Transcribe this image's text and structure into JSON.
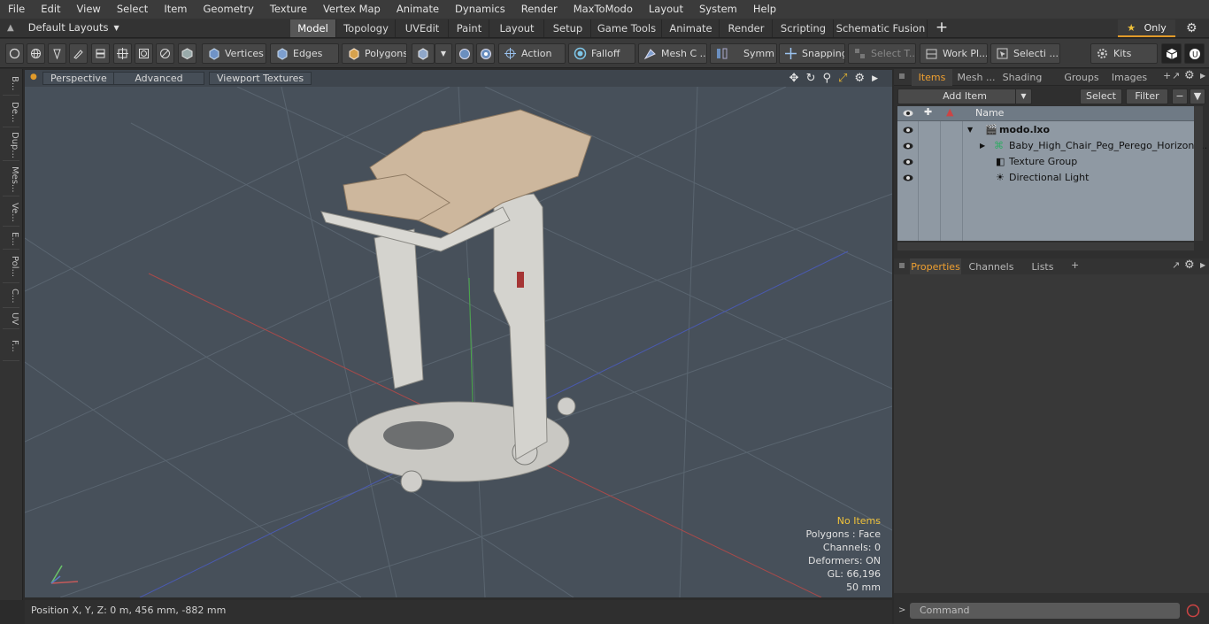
{
  "menubar": {
    "items": [
      "File",
      "Edit",
      "View",
      "Select",
      "Item",
      "Geometry",
      "Texture",
      "Vertex Map",
      "Animate",
      "Dynamics",
      "Render",
      "MaxToModo",
      "Layout",
      "System",
      "Help"
    ]
  },
  "layout_selector": "Default Layouts",
  "mode_tabs": [
    "Model",
    "Topology",
    "UVEdit",
    "Paint",
    "Layout",
    "Setup",
    "Game Tools",
    "Animate",
    "Render",
    "Scripting",
    "Schematic Fusion"
  ],
  "only_label": "Only",
  "toolbar": {
    "vertices": "Vertices",
    "edges": "Edges",
    "polygons": "Polygons",
    "action": "Action",
    "falloff": "Falloff",
    "mesh_c": "Mesh C ...",
    "symm": "Symm ...",
    "snapping": "Snapping",
    "select_t": "Select T...",
    "work_pl": "Work Pl...",
    "selecti": "Selecti ...",
    "kits": "Kits"
  },
  "left_tabs": [
    "B...",
    "De...",
    "Dup...",
    "Mes...",
    "Ve...",
    "E...",
    "Pol...",
    "C...",
    "UV",
    "F..."
  ],
  "viewport": {
    "perspective": "Perspective",
    "advanced": "Advanced",
    "viewport_textures": "Viewport Textures",
    "info": {
      "selection": "No Items",
      "polygons": "Polygons : Face",
      "channels": "Channels: 0",
      "deformers": "Deformers: ON",
      "gl": "GL: 66,196",
      "size": "50 mm"
    }
  },
  "status": "Position X, Y, Z:  0 m, 456 mm, -882 mm",
  "items_panel": {
    "tabs": [
      "Items",
      "Mesh ...",
      "Shading",
      "Groups",
      "Images"
    ],
    "add_item": "Add Item",
    "select": "Select",
    "filter": "Filter",
    "name_header": "Name",
    "rows": [
      {
        "label": "modo.lxo"
      },
      {
        "label": "Baby_High_Chair_Peg_Perego_Horizont..."
      },
      {
        "label": "Texture Group"
      },
      {
        "label": "Directional Light"
      }
    ]
  },
  "properties_panel": {
    "tabs": [
      "Properties",
      "Channels",
      "Lists"
    ]
  },
  "command": {
    "placeholder": "Command"
  },
  "colors": {
    "accent": "#f0a030",
    "viewport_bg": "#47505a",
    "tree_bg": "#8f99a3",
    "info_highlight": "#f0c23a"
  }
}
